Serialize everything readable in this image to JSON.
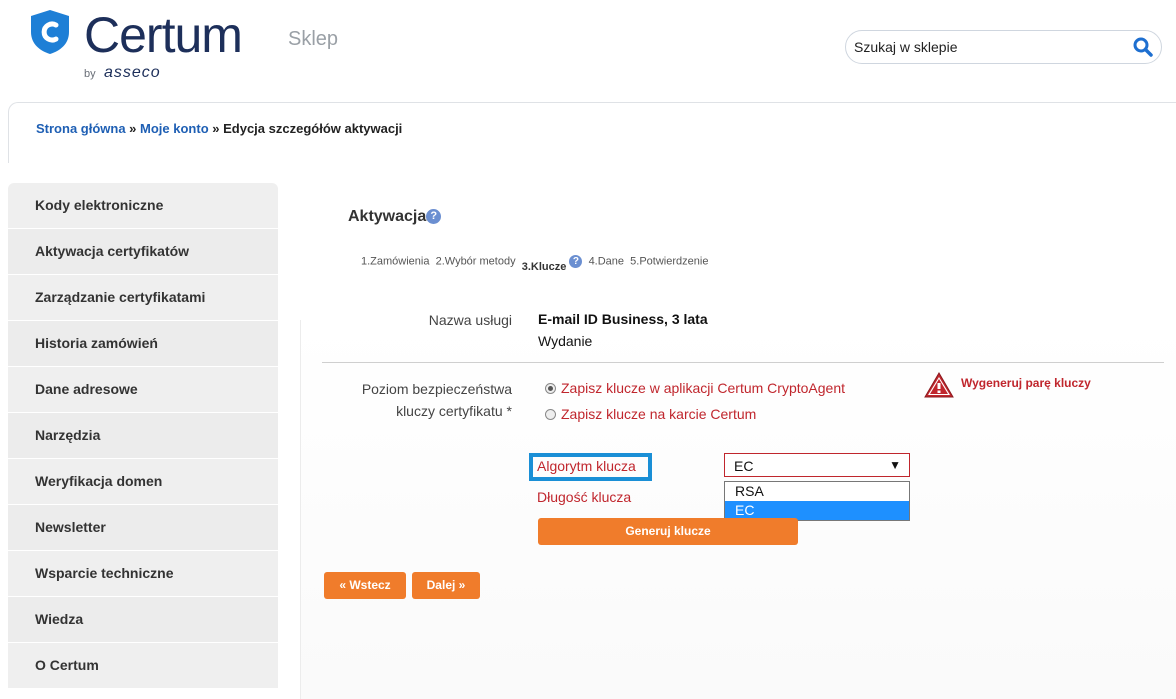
{
  "header": {
    "logo_text": "Certum",
    "logo_sub": "Sklep",
    "logo_by": "by",
    "logo_asseco": "asseco",
    "search_text": "Szukaj w sklepie"
  },
  "breadcrumb": {
    "home": "Strona główna",
    "sep1": " » ",
    "account": "Moje konto",
    "sep2": " » ",
    "current": "Edycja szczegółów aktywacji"
  },
  "sidebar": {
    "items": [
      {
        "label": "Kody elektroniczne"
      },
      {
        "label": "Aktywacja certyfikatów"
      },
      {
        "label": "Zarządzanie certyfikatami"
      },
      {
        "label": "Historia zamówień"
      },
      {
        "label": "Dane adresowe"
      },
      {
        "label": "Narzędzia"
      },
      {
        "label": "Weryfikacja domen"
      },
      {
        "label": "Newsletter"
      },
      {
        "label": "Wsparcie techniczne"
      },
      {
        "label": "Wiedza"
      },
      {
        "label": "O Certum"
      }
    ]
  },
  "main": {
    "title": "Aktywacja",
    "steps": {
      "s1": "1.Zamówienia",
      "s2": "2.Wybór metody",
      "s3": "3.Klucze",
      "s4": "4.Dane",
      "s5": "5.Potwierdzenie"
    },
    "service_label": "Nazwa usługi",
    "service_value": "E-mail ID Business, 3 lata",
    "service_sub": "Wydanie",
    "security_label_1": "Poziom bezpieczeństwa",
    "security_label_2": "kluczy certyfikatu *",
    "option_1": "Zapisz klucze w aplikacji Certum CryptoAgent",
    "option_2": "Zapisz klucze na karcie Certum",
    "warning": "Wygeneruj parę kluczy",
    "algo_label": "Algorytm klucza",
    "length_label": "Długość klucza",
    "algo_selected": "EC",
    "algo_options": [
      "RSA",
      "EC"
    ],
    "generate_button": "Generuj klucze",
    "back_button": "« Wstecz",
    "next_button": "Dalej »"
  }
}
